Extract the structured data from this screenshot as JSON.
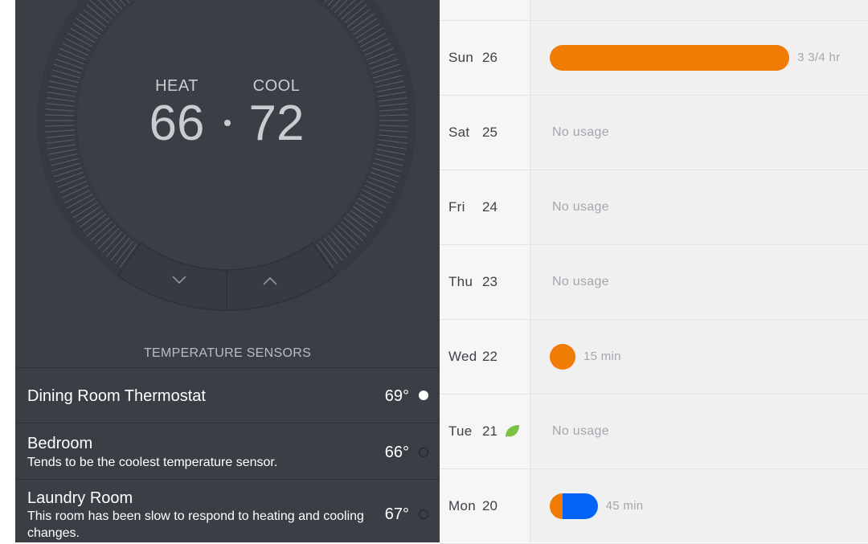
{
  "thermostat": {
    "heat_label": "HEAT",
    "heat_value": "66",
    "cool_label": "COOL",
    "cool_value": "72",
    "down_icon": "chevron-down-icon",
    "up_icon": "chevron-up-icon"
  },
  "sensors": {
    "heading": "TEMPERATURE SENSORS",
    "items": [
      {
        "name": "Dining Room Thermostat",
        "description": "",
        "temp": "69°",
        "active": true
      },
      {
        "name": "Bedroom",
        "description": "Tends to be the coolest temperature sensor.",
        "temp": "66°",
        "active": false
      },
      {
        "name": "Laundry Room",
        "description": "This room has been slow to respond to heating and cooling changes.",
        "temp": "67°",
        "active": false
      }
    ]
  },
  "history": {
    "colors": {
      "heat": "#f07b05",
      "cool": "#0564f5",
      "leaf": "#7cc245"
    },
    "max_hours": 4.0,
    "days": [
      {
        "day": "Sun",
        "date": "26",
        "usage_text": "3 3/4 hr",
        "hours": 3.75,
        "heat_fraction": 1.0,
        "leaf": false
      },
      {
        "day": "Sat",
        "date": "25",
        "usage_text": "No usage",
        "hours": 0,
        "heat_fraction": 0,
        "leaf": false
      },
      {
        "day": "Fri",
        "date": "24",
        "usage_text": "No usage",
        "hours": 0,
        "heat_fraction": 0,
        "leaf": false
      },
      {
        "day": "Thu",
        "date": "23",
        "usage_text": "No usage",
        "hours": 0,
        "heat_fraction": 0,
        "leaf": false
      },
      {
        "day": "Wed",
        "date": "22",
        "usage_text": "15 min",
        "hours": 0.25,
        "heat_fraction": 1.0,
        "leaf": false
      },
      {
        "day": "Tue",
        "date": "21",
        "usage_text": "No usage",
        "hours": 0,
        "heat_fraction": 0,
        "leaf": true
      },
      {
        "day": "Mon",
        "date": "20",
        "usage_text": "45 min",
        "hours": 0.75,
        "heat_fraction": 0.27,
        "leaf": false
      }
    ]
  }
}
